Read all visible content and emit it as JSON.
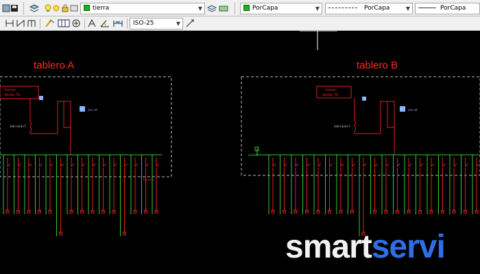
{
  "toolbar1": {
    "layer_combo": {
      "value": "tierra",
      "color": "#00c000"
    },
    "color_combo": {
      "value": "PorCapa",
      "color": "#00c000"
    },
    "linetype_combo": {
      "value": "PorCapa"
    },
    "lineweight_combo": {
      "value": "PorCapa"
    }
  },
  "toolbar2": {
    "dimstyle_combo": {
      "value": "ISO-25"
    }
  },
  "drawing": {
    "panel_a_title": "tablero A",
    "panel_b_title": "tablero B"
  },
  "watermark": {
    "part1": "smart",
    "part2": "servi"
  },
  "colors": {
    "background": "#000000",
    "title_red": "#ff2a1a",
    "wire_green": "#33cc33",
    "wire_red": "#e02020",
    "dashed_border": "#c0c0c0",
    "brand_blue": "#2f6fe6"
  },
  "icons": {
    "tb1": [
      "app-icon",
      "save-icon",
      "layer-manager-icon",
      "bulb-icon",
      "sun-icon",
      "lock-icon",
      "layer-state-icon",
      "make-current-icon"
    ],
    "tb2": [
      "dim-linear-icon",
      "dim-aligned-icon",
      "dim-baseline-icon",
      "quick-dim-icon",
      "tolerance-icon",
      "center-mark-icon",
      "dim-text-icon",
      "dim-angle-icon",
      "dim-update-icon",
      "dimstyle-icon"
    ]
  }
}
